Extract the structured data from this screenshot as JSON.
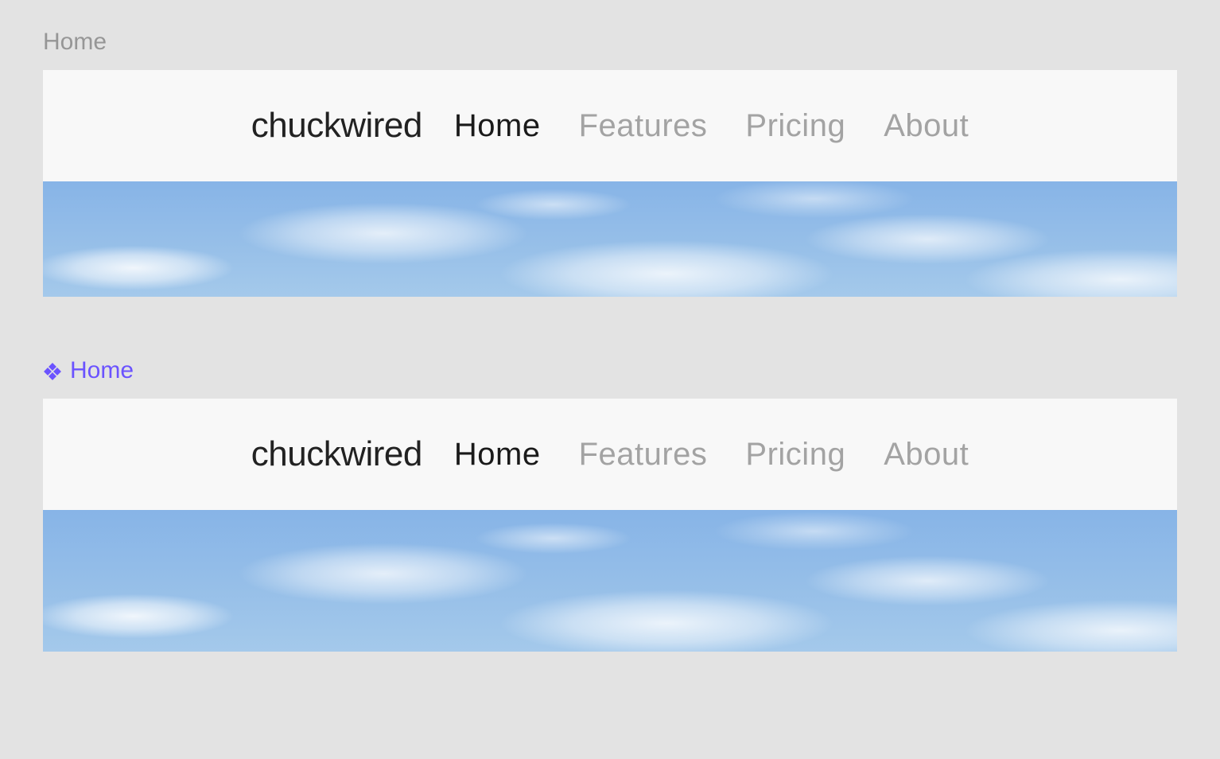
{
  "examples": [
    {
      "label": "Home",
      "is_component": false,
      "navbar": {
        "brand": "chuckwired",
        "links": [
          {
            "label": "Home",
            "active": true
          },
          {
            "label": "Features",
            "active": false
          },
          {
            "label": "Pricing",
            "active": false
          },
          {
            "label": "About",
            "active": false
          }
        ]
      }
    },
    {
      "label": "Home",
      "is_component": true,
      "navbar": {
        "brand": "chuckwired",
        "links": [
          {
            "label": "Home",
            "active": true
          },
          {
            "label": "Features",
            "active": false
          },
          {
            "label": "Pricing",
            "active": false
          },
          {
            "label": "About",
            "active": false
          }
        ]
      }
    }
  ]
}
